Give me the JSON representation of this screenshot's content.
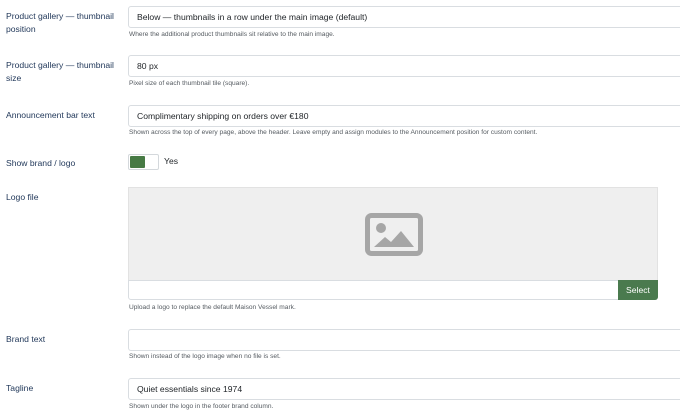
{
  "settings": {
    "gallery_position": {
      "label": "Product gallery — thumbnail position",
      "value": "Below — thumbnails in a row under the main image (default)",
      "hint": "Where the additional product thumbnails sit relative to the main image."
    },
    "thumbnail_size": {
      "label": "Product gallery — thumbnail size",
      "value": "80 px",
      "hint": "Pixel size of each thumbnail tile (square)."
    },
    "announcement": {
      "label": "Announcement bar text",
      "value": "Complimentary shipping on orders over €180",
      "hint": "Shown across the top of every page, above the header. Leave empty and assign modules to the Announcement position for custom content."
    },
    "show_brand": {
      "label": "Show brand / logo",
      "state_text": "Yes",
      "accent_color": "#477a44"
    },
    "logo_file": {
      "label": "Logo file",
      "select_label": "Select",
      "hint": "Upload a logo to replace the default Maison Vessel mark.",
      "placeholder_icon": "image-placeholder-icon"
    },
    "brand_text": {
      "label": "Brand text",
      "value": "",
      "hint": "Shown instead of the logo image when no file is set."
    },
    "tagline": {
      "label": "Tagline",
      "value": "Quiet essentials since 1974",
      "hint": "Shown under the logo in the footer brand column."
    }
  }
}
